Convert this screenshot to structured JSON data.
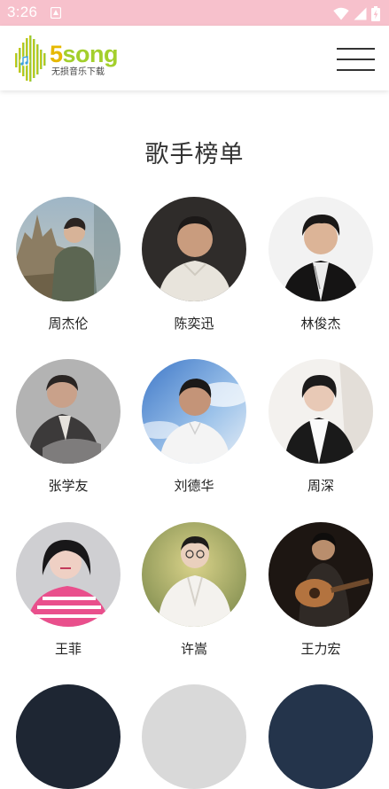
{
  "status_bar": {
    "time": "3:26",
    "icons": [
      "notification-icon",
      "wifi-icon",
      "signal-icon",
      "battery-icon"
    ]
  },
  "header": {
    "logo_main": "5song",
    "logo_number": "5",
    "logo_word": "song",
    "logo_tagline": "无损音乐下载",
    "menu_icon": "hamburger-menu-icon"
  },
  "page": {
    "title": "歌手榜单"
  },
  "artists": [
    {
      "name": "周杰伦"
    },
    {
      "name": "陈奕迅"
    },
    {
      "name": "林俊杰"
    },
    {
      "name": "张学友"
    },
    {
      "name": "刘德华"
    },
    {
      "name": "周深"
    },
    {
      "name": "王菲"
    },
    {
      "name": "许嵩"
    },
    {
      "name": "王力宏"
    }
  ],
  "colors": {
    "status_bar_bg": "#f7c1cc",
    "logo_green": "#a3cf2c",
    "logo_yellow": "#e6b800",
    "text_dark": "#333333"
  }
}
